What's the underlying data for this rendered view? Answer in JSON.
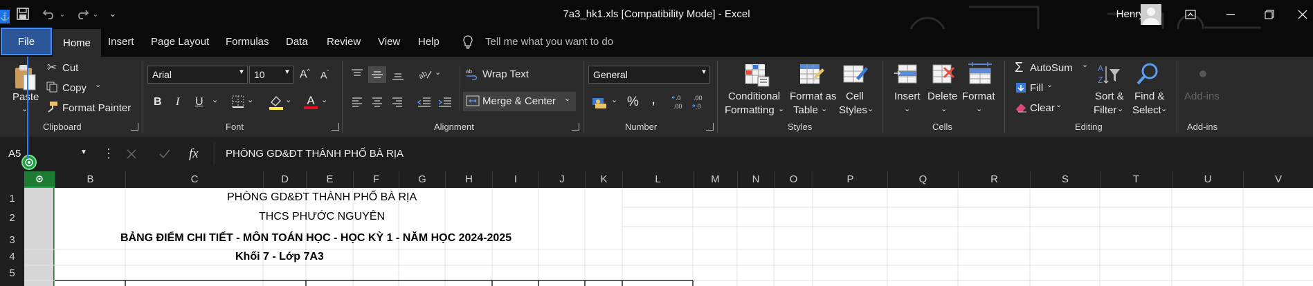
{
  "window": {
    "title": "7a3_hk1.xls  [Compatibility Mode]  -  Excel",
    "user": "Henry .",
    "qat_more": "⌄"
  },
  "tabs": [
    "File",
    "Home",
    "Insert",
    "Page Layout",
    "Formulas",
    "Data",
    "Review",
    "View",
    "Help"
  ],
  "tell_me": "Tell me what you want to do",
  "clipboard": {
    "paste": "Paste",
    "cut": "Cut",
    "copy": "Copy",
    "format_painter": "Format Painter",
    "group": "Clipboard"
  },
  "font": {
    "name": "Arial",
    "size": "10",
    "bold": "B",
    "italic": "I",
    "underline": "U",
    "group": "Font",
    "font_color": "#e81123",
    "highlight_color": "#ffeb3b"
  },
  "alignment": {
    "wrap_text": "Wrap Text",
    "merge_center": "Merge & Center",
    "group": "Alignment"
  },
  "number": {
    "format": "General",
    "percent": "%",
    "comma": ",",
    "inc_decimal": "←.0\n.00",
    "dec_decimal": ".00\n→.0",
    "group": "Number"
  },
  "styles": {
    "conditional_1": "Conditional",
    "conditional_2": "Formatting",
    "format_table_1": "Format as",
    "format_table_2": "Table",
    "cell_styles_1": "Cell",
    "cell_styles_2": "Styles",
    "group": "Styles"
  },
  "cells": {
    "insert": "Insert",
    "delete": "Delete",
    "format": "Format",
    "group": "Cells"
  },
  "editing": {
    "autosum": "AutoSum",
    "fill": "Fill",
    "clear": "Clear",
    "sort_1": "Sort &",
    "sort_2": "Filter",
    "find_1": "Find &",
    "find_2": "Select",
    "group": "Editing"
  },
  "addins": {
    "label": "Add-ins",
    "group": "Add-ins"
  },
  "formula_bar": {
    "name_box": "A5",
    "fx": "fx",
    "content": "PHÒNG GD&ĐT THÀNH PHỐ BÀ RỊA"
  },
  "columns": [
    "B",
    "C",
    "D",
    "E",
    "F",
    "G",
    "H",
    "I",
    "J",
    "K",
    "L",
    "M",
    "N",
    "O",
    "P",
    "Q",
    "R",
    "S",
    "T",
    "U",
    "V"
  ],
  "rows": [
    "1",
    "2",
    "3",
    "4",
    "5"
  ],
  "sheet": {
    "r1": "PHÒNG GD&ĐT THÀNH PHỐ BÀ RỊA",
    "r2": "THCS PHƯỚC NGUYÊN",
    "r3": "BẢNG ĐIỂM CHI TIẾT - MÔN TOÁN HỌC - HỌC KỲ 1 - NĂM HỌC 2024-2025",
    "r4": "Khối 7 - Lớp 7A3"
  },
  "colors": {
    "accent_file": "#2b579a",
    "selection": "#1e7b34"
  }
}
